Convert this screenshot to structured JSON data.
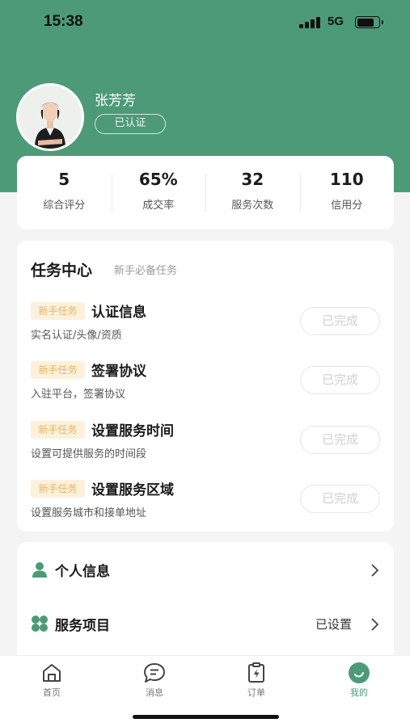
{
  "status_bar": {
    "time": "15:38",
    "network": "5G",
    "battery_level": 0.8
  },
  "profile": {
    "name": "张芳芳",
    "badge": "已认证"
  },
  "stats": [
    {
      "value": "5",
      "label": "综合评分"
    },
    {
      "value": "65%",
      "label": "成交率"
    },
    {
      "value": "32",
      "label": "服务次数"
    },
    {
      "value": "110",
      "label": "信用分"
    }
  ],
  "tasks": {
    "title": "任务中心",
    "subtitle": "新手必备任务",
    "items": [
      {
        "tag": "新手任务",
        "name": "认证信息",
        "desc": "实名认证/头像/资质",
        "status": "已完成"
      },
      {
        "tag": "新手任务",
        "name": "签署协议",
        "desc": "入驻平台，签署协议",
        "status": "已完成"
      },
      {
        "tag": "新手任务",
        "name": "设置服务时间",
        "desc": "设置可提供服务的时间段",
        "status": "已完成"
      },
      {
        "tag": "新手任务",
        "name": "设置服务区域",
        "desc": "设置服务城市和接单地址",
        "status": "已完成"
      }
    ]
  },
  "menu": [
    {
      "label": "个人信息",
      "value": "",
      "icon": "person-icon"
    },
    {
      "label": "服务项目",
      "value": "已设置",
      "icon": "clover-icon"
    }
  ],
  "tabs": [
    {
      "label": "首页",
      "icon": "home-icon",
      "active": false
    },
    {
      "label": "消息",
      "icon": "message-icon",
      "active": false
    },
    {
      "label": "订单",
      "icon": "order-icon",
      "active": false
    },
    {
      "label": "我的",
      "icon": "profile-icon",
      "active": true
    }
  ],
  "colors": {
    "brand": "#4d9a79",
    "tag_bg": "#fdf1dc",
    "tag_text": "#e8b463"
  }
}
